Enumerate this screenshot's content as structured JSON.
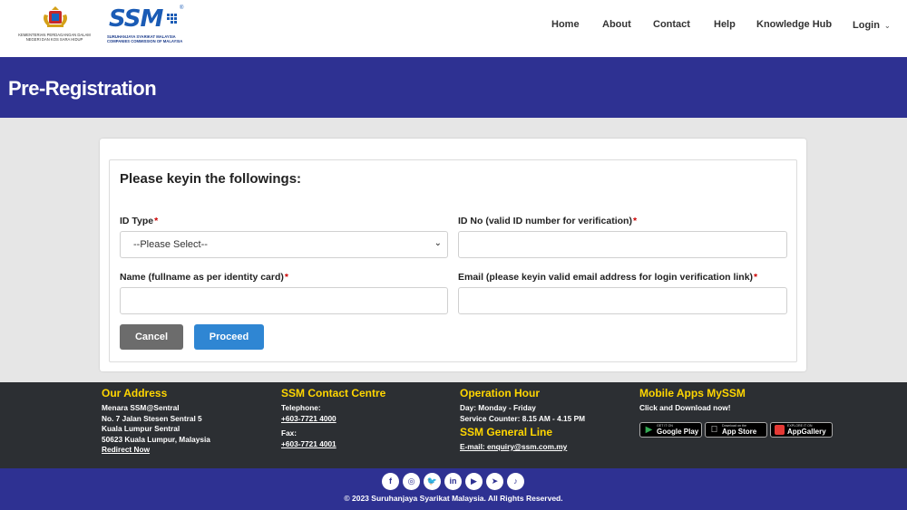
{
  "header": {
    "gov_logo_text": "KEMENTERIAN PERDAGANGAN DALAM NEGERI DAN KOS SARA HIDUP",
    "ssm_logo_text": "SSM",
    "ssm_logo_reg": "®",
    "ssm_logo_sub": "SURUHANJAYA SYARIKAT MALAYSIA COMPANIES COMMISSION OF MALAYSIA",
    "nav": [
      "Home",
      "About",
      "Contact",
      "Help",
      "Knowledge Hub",
      "Login"
    ]
  },
  "banner": {
    "title": "Pre-Registration"
  },
  "form": {
    "heading": "Please keyin the followings:",
    "id_type_label": "ID Type",
    "id_type_value": "--Please Select--",
    "id_no_label": "ID No (valid ID number for verification)",
    "id_no_value": "",
    "name_label": "Name (fullname as per identity card)",
    "name_value": "",
    "email_label": "Email (please keyin valid email address for login verification link)",
    "email_value": "",
    "required_mark": "*",
    "cancel_label": "Cancel",
    "proceed_label": "Proceed"
  },
  "footer": {
    "address": {
      "heading": "Our Address",
      "lines": [
        "Menara SSM@Sentral",
        "No. 7 Jalan Stesen Sentral 5",
        "Kuala Lumpur Sentral",
        "50623 Kuala Lumpur, Malaysia"
      ],
      "link": "Redirect Now"
    },
    "contact": {
      "heading": "SSM Contact Centre",
      "tel_label": "Telephone:",
      "tel": "+603-7721 4000",
      "fax_label": "Fax:",
      "fax": "+603-7721 4001"
    },
    "hours": {
      "heading": "Operation Hour",
      "day": "Day: Monday - Friday",
      "counter": "Service Counter: 8.15 AM - 4.15 PM",
      "general_heading": "SSM General Line",
      "email": "E-mail: enquiry@ssm.com.my"
    },
    "apps": {
      "heading": "Mobile Apps MySSM",
      "subtitle": "Click and Download now!",
      "google_small": "GET IT ON",
      "google_big": "Google Play",
      "apple_small": "Download on the",
      "apple_big": "App Store",
      "huawei_small": "EXPLORE IT ON",
      "huawei_big": "AppGallery"
    }
  },
  "bottom": {
    "social_icons": [
      "facebook-icon",
      "instagram-icon",
      "twitter-icon",
      "linkedin-icon",
      "youtube-icon",
      "telegram-icon",
      "tiktok-icon"
    ],
    "social_glyphs": [
      "f",
      "◎",
      "🐦",
      "in",
      "▶",
      "➤",
      "♪"
    ],
    "copyright": "© 2023 Suruhanjaya Syarikat Malaysia. All Rights Reserved."
  },
  "colors": {
    "brand_blue": "#2e3192",
    "footer_bg": "#2c2f33",
    "footer_heading": "#ffd600",
    "proceed": "#2f86d3",
    "cancel": "#6c6c6c",
    "required": "#cc0000"
  }
}
